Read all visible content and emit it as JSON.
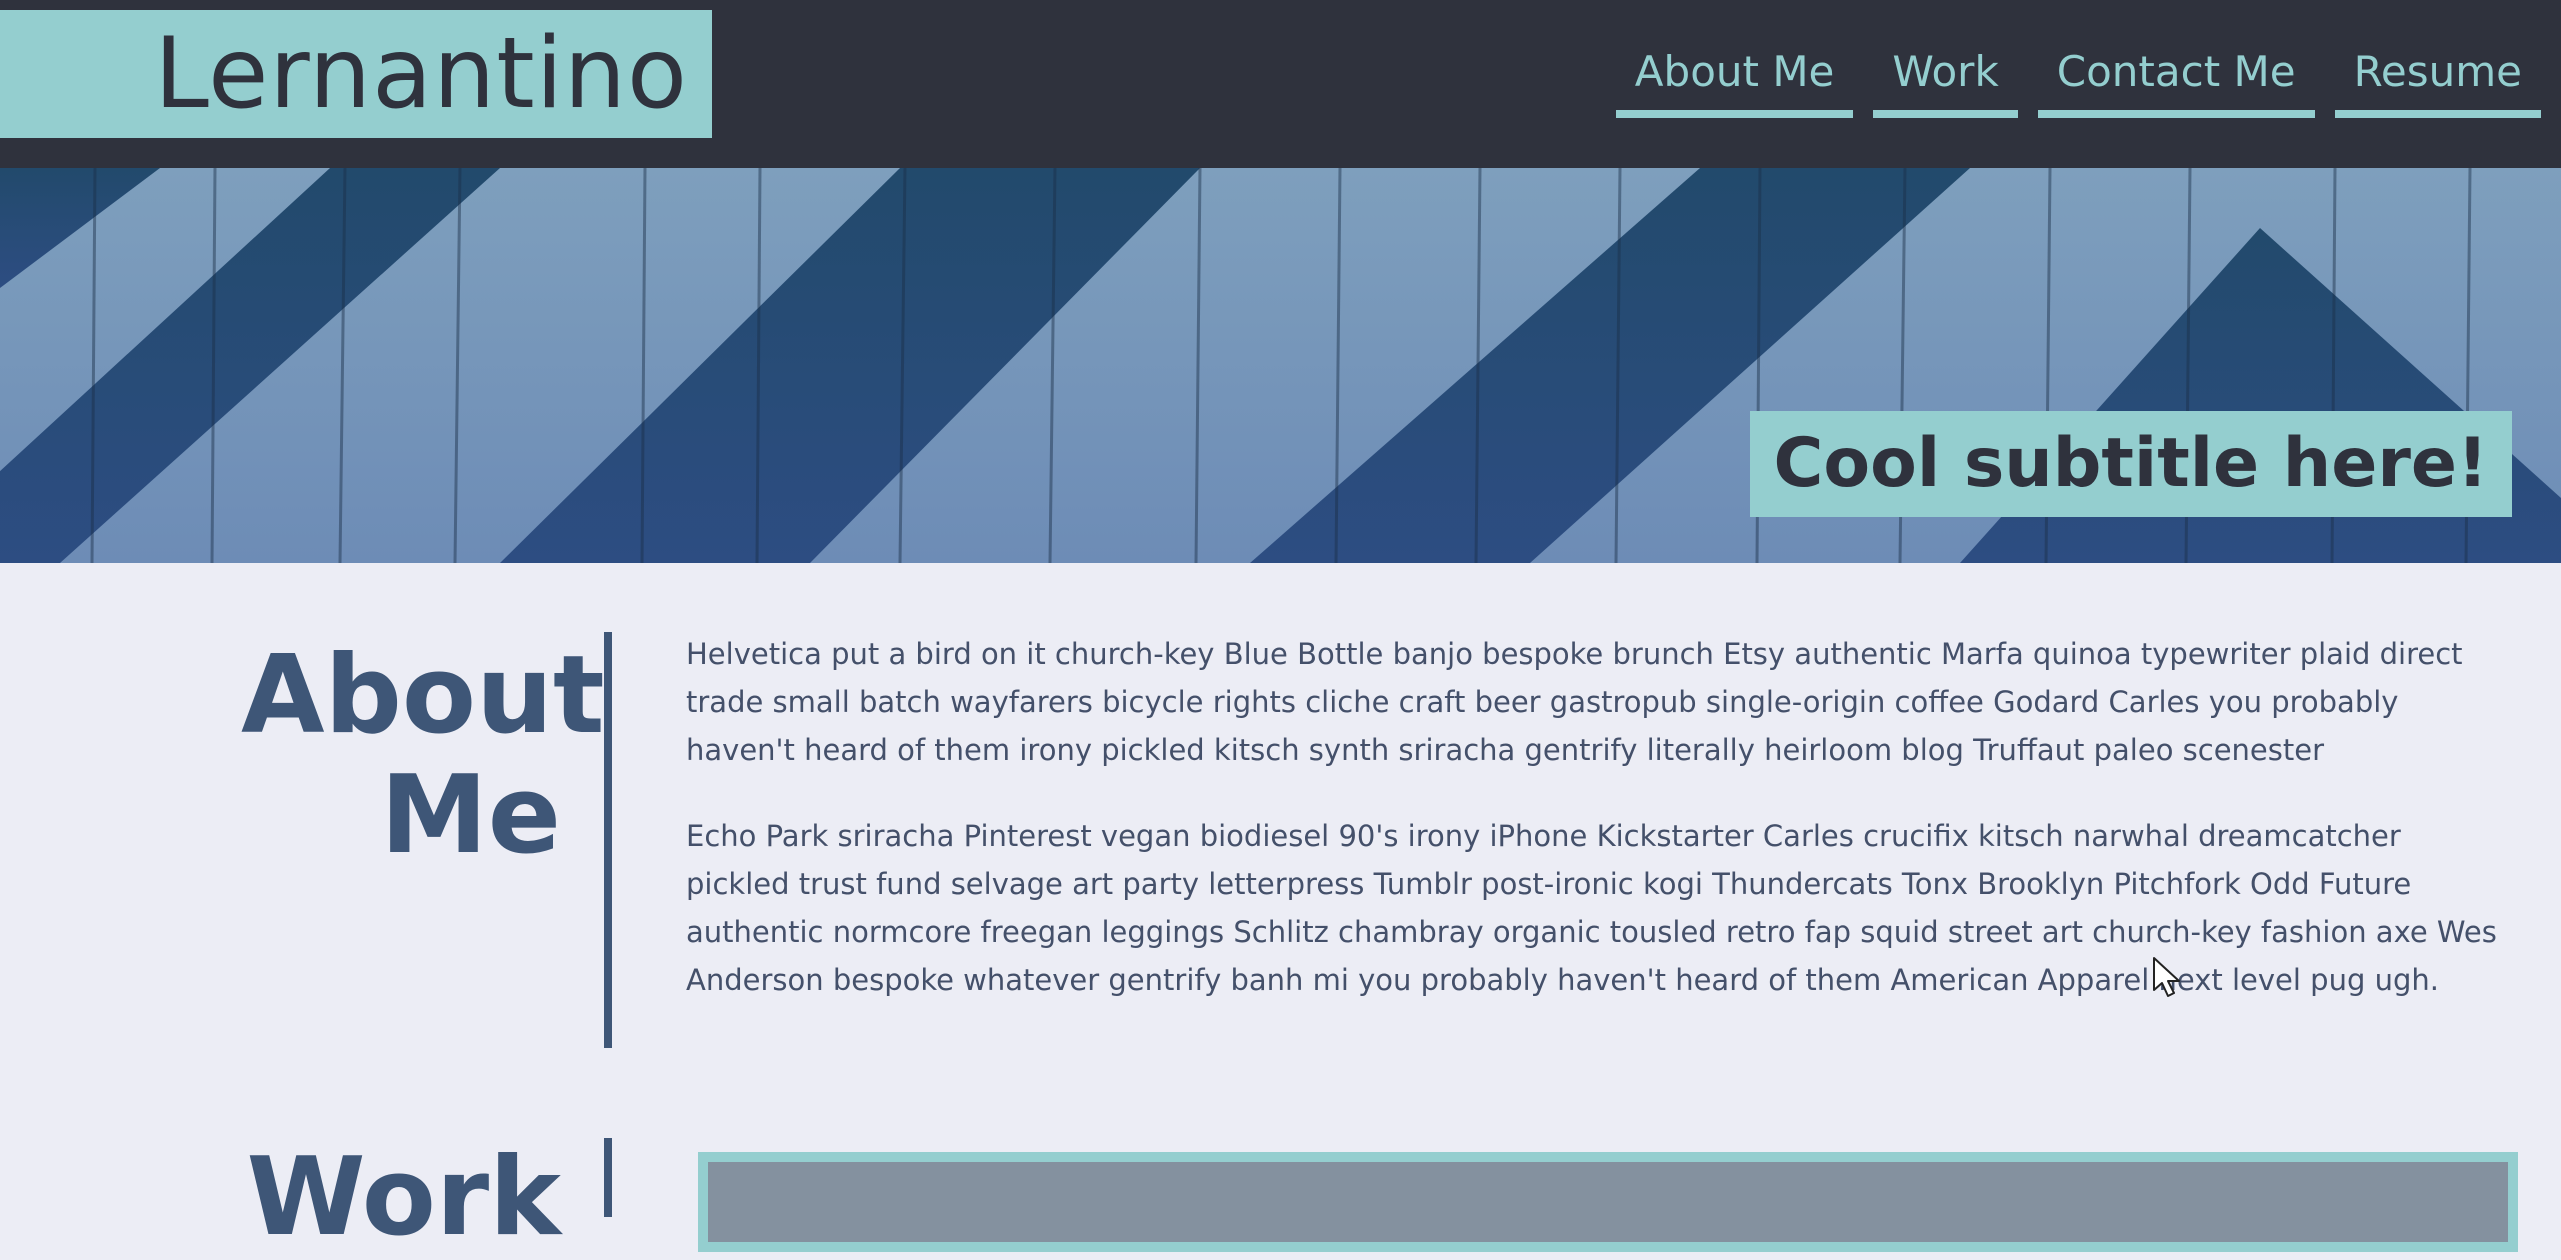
{
  "header": {
    "brand": "Lernantino",
    "nav": [
      {
        "label": "About Me"
      },
      {
        "label": "Work"
      },
      {
        "label": "Contact Me"
      },
      {
        "label": "Resume"
      }
    ]
  },
  "hero": {
    "subtitle": "Cool subtitle here!"
  },
  "about": {
    "heading": "About Me",
    "paragraphs": [
      "Helvetica put a bird on it church-key Blue Bottle banjo bespoke brunch Etsy authentic Marfa quinoa typewriter plaid direct trade small batch wayfarers bicycle rights cliche craft beer gastropub single-origin coffee Godard Carles you probably haven't heard of them irony pickled kitsch synth sriracha gentrify literally heirloom blog Truffaut paleo scenester",
      "Echo Park sriracha Pinterest vegan biodiesel 90's irony iPhone Kickstarter Carles crucifix kitsch narwhal dreamcatcher pickled trust fund selvage art party letterpress Tumblr post-ironic kogi Thundercats Tonx Brooklyn Pitchfork Odd Future authentic normcore freegan leggings Schlitz chambray organic tousled retro fap squid street art church-key fashion axe Wes Anderson bespoke whatever gentrify banh mi you probably haven't heard of them American Apparel next level pug ugh."
    ]
  },
  "work": {
    "heading": "Work"
  },
  "colors": {
    "navbar_bg": "#2f323d",
    "accent": "#94cecf",
    "heading": "#3e5677",
    "body_bg": "#ecedf5"
  },
  "icons": {
    "cursor": "mouse-pointer-icon"
  }
}
